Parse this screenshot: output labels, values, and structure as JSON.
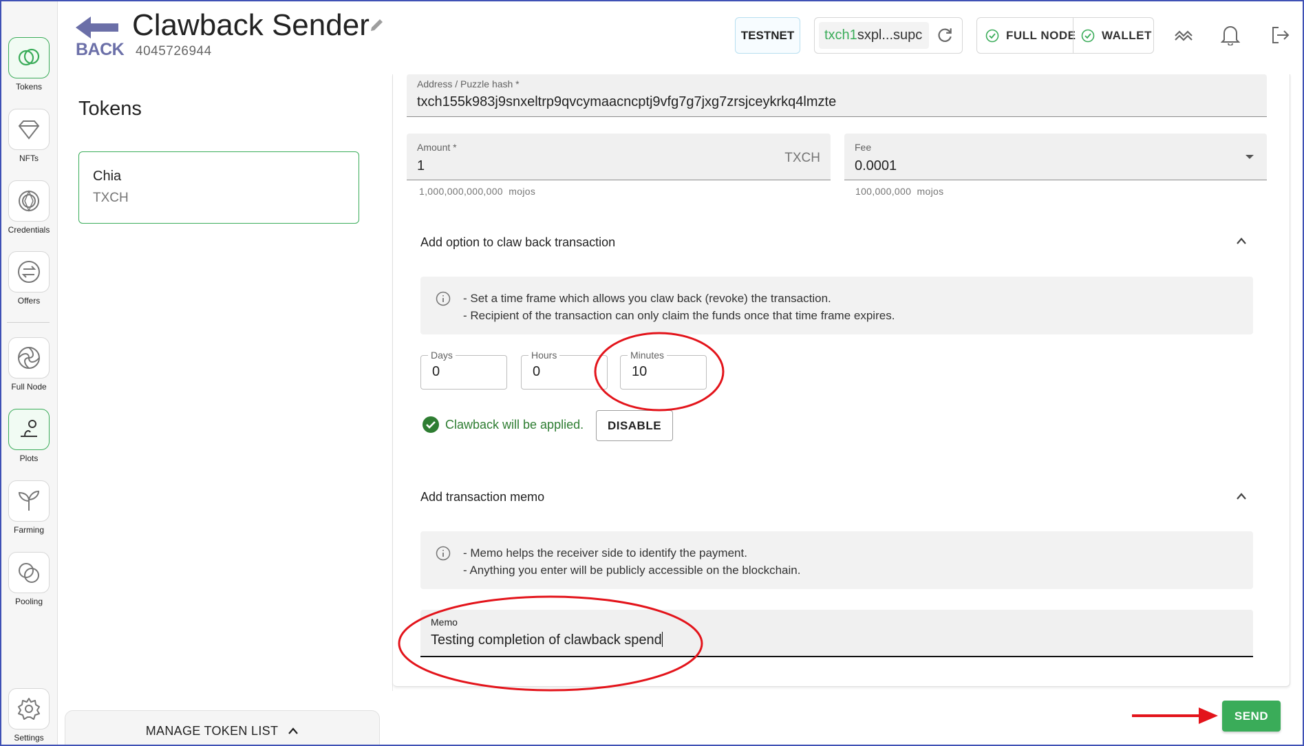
{
  "sidebar": {
    "items": [
      {
        "label": "Tokens",
        "icon": "tokens-icon"
      },
      {
        "label": "NFTs",
        "icon": "diamond-icon"
      },
      {
        "label": "Credentials",
        "icon": "credentials-icon"
      },
      {
        "label": "Offers",
        "icon": "swap-icon"
      },
      {
        "label": "Full Node",
        "icon": "aperture-icon"
      },
      {
        "label": "Plots",
        "icon": "plots-icon"
      },
      {
        "label": "Farming",
        "icon": "sprout-icon"
      },
      {
        "label": "Pooling",
        "icon": "pooling-icon"
      },
      {
        "label": "Settings",
        "icon": "gear-icon"
      }
    ]
  },
  "header": {
    "back_label": "BACK",
    "title": "Clawback Sender",
    "wallet_id": "4045726944",
    "network": "TESTNET",
    "address_prefix": "txch1",
    "address_rest": "sxpl...supc",
    "full_node": "FULL NODE",
    "wallet": "WALLET"
  },
  "tokens": {
    "heading": "Tokens",
    "items": [
      {
        "name": "Chia",
        "symbol": "TXCH"
      }
    ],
    "manage_label": "MANAGE TOKEN LIST"
  },
  "form": {
    "address": {
      "label": "Address / Puzzle hash *",
      "value": "txch155k983j9snxeltrp9qvcymaacncptj9vfg7g7jxg7zrsjceykrkq4lmzte"
    },
    "amount": {
      "label": "Amount *",
      "value": "1",
      "unit": "TXCH",
      "mojos_value": "1,000,000,000,000",
      "mojos_unit": "mojos"
    },
    "fee": {
      "label": "Fee",
      "value": "0.0001",
      "mojos_value": "100,000,000",
      "mojos_unit": "mojos"
    },
    "clawback": {
      "title": "Add option to claw back transaction",
      "info": [
        "- Set a time frame which allows you claw back (revoke) the transaction.",
        "- Recipient of the transaction can only claim the funds once that time frame expires."
      ],
      "days": {
        "label": "Days",
        "value": "0"
      },
      "hours": {
        "label": "Hours",
        "value": "0"
      },
      "minutes": {
        "label": "Minutes",
        "value": "10"
      },
      "status": "Clawback will be applied.",
      "disable_label": "DISABLE"
    },
    "memo": {
      "title": "Add transaction memo",
      "info": [
        "- Memo helps the receiver side to identify the payment.",
        "- Anything you enter will be publicly accessible on the blockchain."
      ],
      "label": "Memo",
      "value": "Testing completion of clawback spend"
    },
    "send_label": "SEND"
  },
  "colors": {
    "accent": "#3aac59",
    "back_arrow": "#6b6fa8",
    "annotation": "#e3141b"
  }
}
